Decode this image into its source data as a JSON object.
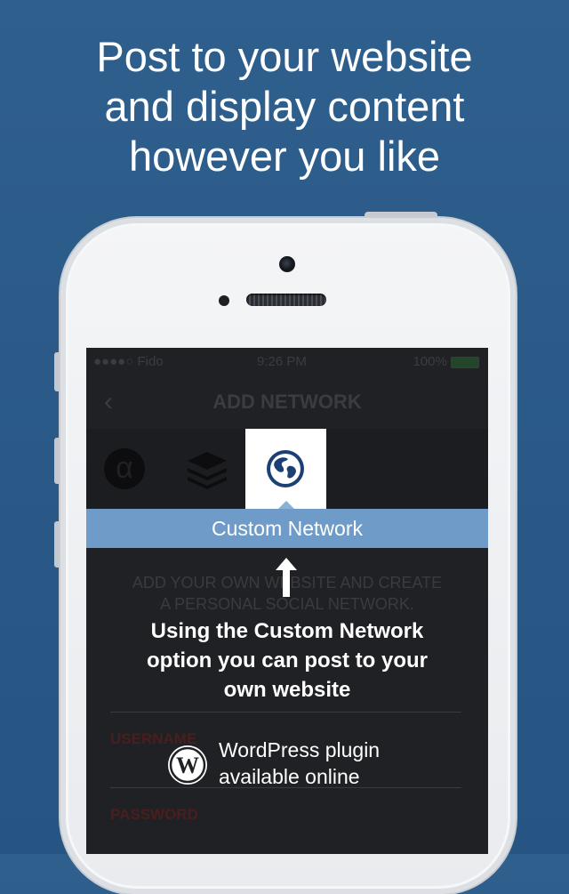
{
  "headline": {
    "lines": [
      "Post to your website",
      "and display content",
      "however you like"
    ]
  },
  "status_bar": {
    "carrier": "●●●●○ Fido",
    "time": "9:26 PM",
    "battery": "100%"
  },
  "nav": {
    "back_icon": "chevron-left-icon",
    "title": "ADD NETWORK"
  },
  "network_icons": [
    "app-net-icon",
    "buffer-layers-icon",
    "globe-icon"
  ],
  "selected_tab_label": "Custom Network",
  "background_text": {
    "line1": "ADD YOUR OWN WEBSITE AND CREATE",
    "line2": "A PERSONAL SOCIAL NETWORK.",
    "username_label": "USERNAME",
    "password_label": "PASSWORD"
  },
  "overlay": {
    "lines": [
      "Using the Custom Network",
      "option you can post to your",
      "own website"
    ],
    "plugin_lines": [
      "WordPress plugin",
      "available online"
    ],
    "plugin_icon": "wordpress-icon"
  },
  "colors": {
    "background": "#2b5a88",
    "banner": "#6f9bc8",
    "screen": "#202124"
  }
}
